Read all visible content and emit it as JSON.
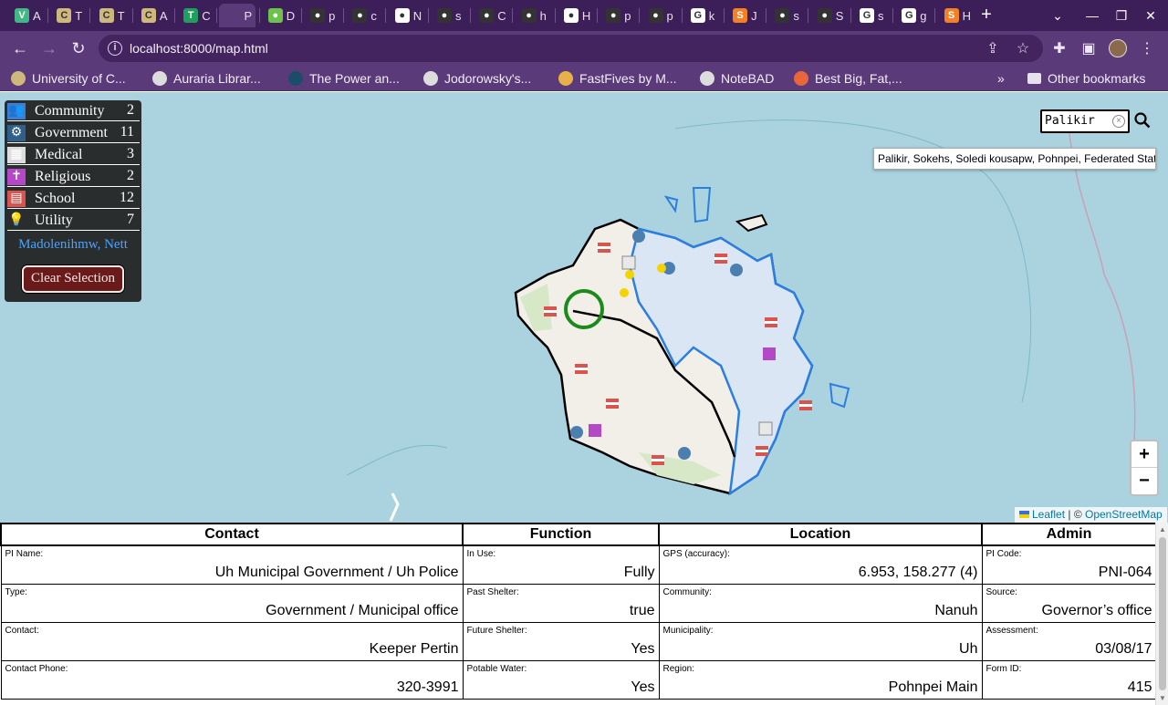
{
  "browser": {
    "url": "localhost:8000/map.html",
    "tabs": [
      {
        "label": "A",
        "icon_color": "#41b883",
        "glyph": "V"
      },
      {
        "label": "T",
        "icon_color": "#cfb87c",
        "glyph": "C"
      },
      {
        "label": "T",
        "icon_color": "#cfb87c",
        "glyph": "C"
      },
      {
        "label": "A",
        "icon_color": "#cfb87c",
        "glyph": "C"
      },
      {
        "label": "C",
        "icon_color": "#1e9e5f",
        "glyph": "T"
      },
      {
        "label": "P",
        "icon_color": "#5b3a7a",
        "glyph": ""
      },
      {
        "label": "D",
        "icon_color": "#6cc24a",
        "glyph": "●"
      },
      {
        "label": "p",
        "icon_color": "#333333",
        "glyph": "●"
      },
      {
        "label": "c",
        "icon_color": "#333333",
        "glyph": "●"
      },
      {
        "label": "N",
        "icon_color": "#ffffff",
        "glyph": "●"
      },
      {
        "label": "s",
        "icon_color": "#333333",
        "glyph": "●"
      },
      {
        "label": "C",
        "icon_color": "#333333",
        "glyph": "●"
      },
      {
        "label": "h",
        "icon_color": "#333333",
        "glyph": "●"
      },
      {
        "label": "H",
        "icon_color": "#ffffff",
        "glyph": "●"
      },
      {
        "label": "p",
        "icon_color": "#333333",
        "glyph": "●"
      },
      {
        "label": "p",
        "icon_color": "#333333",
        "glyph": "●"
      },
      {
        "label": "k",
        "icon_color": "#ffffff",
        "glyph": "G"
      },
      {
        "label": "J",
        "icon_color": "#f48024",
        "glyph": "S"
      },
      {
        "label": "s",
        "icon_color": "#333333",
        "glyph": "●"
      },
      {
        "label": "S",
        "icon_color": "#333333",
        "glyph": "●"
      },
      {
        "label": "s",
        "icon_color": "#ffffff",
        "glyph": "G"
      },
      {
        "label": "g",
        "icon_color": "#ffffff",
        "glyph": "G"
      },
      {
        "label": "H",
        "icon_color": "#f48024",
        "glyph": "S"
      }
    ],
    "bookmarks": [
      {
        "label": "University of C...",
        "icon_color": "#cfb87c"
      },
      {
        "label": "Auraria Librar...",
        "icon_color": "#dddddd"
      },
      {
        "label": "The Power an...",
        "icon_color": "#1b4d6b"
      },
      {
        "label": "Jodorowsky's...",
        "icon_color": "#dddddd"
      },
      {
        "label": "FastFives by M...",
        "icon_color": "#e8b04a"
      },
      {
        "label": "NoteBAD",
        "icon_color": "#dddddd"
      },
      {
        "label": "Best Big, Fat,...",
        "icon_color": "#e8663a"
      }
    ],
    "other_bookmarks": "Other bookmarks",
    "overflow": "»"
  },
  "legend": {
    "items": [
      {
        "label": "Community",
        "count": "2",
        "icon": "community-icon"
      },
      {
        "label": "Government",
        "count": "11",
        "icon": "gear-icon"
      },
      {
        "label": "Medical",
        "count": "3",
        "icon": "hospital-icon"
      },
      {
        "label": "Religious",
        "count": "2",
        "icon": "religious-icon"
      },
      {
        "label": "School",
        "count": "12",
        "icon": "books-icon"
      },
      {
        "label": "Utility",
        "count": "7",
        "icon": "lightbulb-icon"
      }
    ],
    "municipality": "Madolenihmw, Nett",
    "clear_label": "Clear Selection"
  },
  "search": {
    "value": "Palikir",
    "result": "Palikir, Sokehs, Soledi kousapw, Pohnpei, Federated States of Micronesia"
  },
  "map": {
    "zoom_in": "+",
    "zoom_out": "−",
    "attribution_leaflet": "Leaflet",
    "attribution_sep": " | © ",
    "attribution_osm": "OpenStreetMap",
    "colors": {
      "water": "#aad3df",
      "land": "#f2efe9",
      "selected": "#dbe6f5",
      "selected_border": "#2b7fe0"
    }
  },
  "table": {
    "headers": [
      "Contact",
      "Function",
      "Location",
      "Admin"
    ],
    "rows": [
      [
        {
          "label": "PI Name:",
          "value": "Uh Municipal Government / Uh Police"
        },
        {
          "label": "In Use:",
          "value": "Fully"
        },
        {
          "label": "GPS (accuracy):",
          "value": "6.953, 158.277 (4)"
        },
        {
          "label": "PI Code:",
          "value": "PNI-064"
        }
      ],
      [
        {
          "label": "Type:",
          "value": "Government / Municipal office"
        },
        {
          "label": "Past Shelter:",
          "value": "true"
        },
        {
          "label": "Community:",
          "value": "Nanuh"
        },
        {
          "label": "Source:",
          "value": "Governor’s office"
        }
      ],
      [
        {
          "label": "Contact:",
          "value": "Keeper Pertin"
        },
        {
          "label": "Future Shelter:",
          "value": "Yes"
        },
        {
          "label": "Municipality:",
          "value": "Uh"
        },
        {
          "label": "Assessment:",
          "value": "03/08/17"
        }
      ],
      [
        {
          "label": "Contact Phone:",
          "value": "320-3991"
        },
        {
          "label": "Potable Water:",
          "value": "Yes"
        },
        {
          "label": "Region:",
          "value": "Pohnpei Main"
        },
        {
          "label": "Form ID:",
          "value": "415"
        }
      ]
    ]
  }
}
